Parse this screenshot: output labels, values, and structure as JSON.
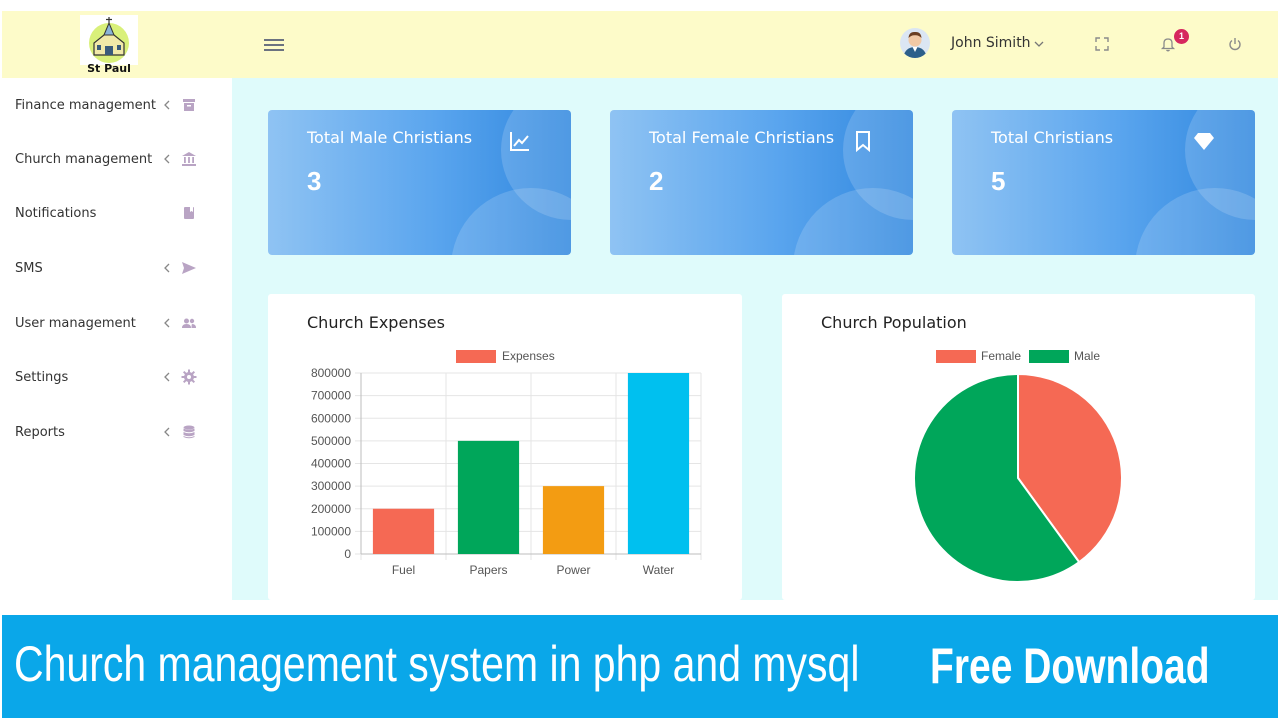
{
  "header": {
    "logo_text": "St Paul",
    "user_name": "John Simith",
    "notification_count": "1",
    "icons": [
      "menu-icon",
      "fullscreen-icon",
      "bell-icon",
      "power-icon"
    ]
  },
  "sidebar": {
    "items": [
      {
        "label": "Finance management",
        "icon": "archive-icon",
        "has_caret": true
      },
      {
        "label": "Church management",
        "icon": "bank-icon",
        "has_caret": true
      },
      {
        "label": "Notifications",
        "icon": "bookmark-icon",
        "has_caret": false
      },
      {
        "label": "SMS",
        "icon": "send-icon",
        "has_caret": true
      },
      {
        "label": "User management",
        "icon": "users-icon",
        "has_caret": true
      },
      {
        "label": "Settings",
        "icon": "gear-icon",
        "has_caret": true
      },
      {
        "label": "Reports",
        "icon": "database-icon",
        "has_caret": true
      }
    ]
  },
  "stats": [
    {
      "title": "Total Male Christians",
      "value": "3",
      "icon": "chart-line-icon"
    },
    {
      "title": "Total Female Christians",
      "value": "2",
      "icon": "bookmark-icon"
    },
    {
      "title": "Total Christians",
      "value": "5",
      "icon": "diamond-icon"
    }
  ],
  "colors": {
    "header_bg": "#fdfbc9",
    "content_bg": "#dffbfb",
    "banner_bg": "#0aa7e9",
    "fuel": "#f56954",
    "papers": "#00a65a",
    "power": "#f39c12",
    "water": "#00c0ef"
  },
  "expenses_card": {
    "title": "Church Expenses"
  },
  "population_card": {
    "title": "Church Population"
  },
  "chart_data": [
    {
      "type": "bar",
      "title": "Church Expenses",
      "categories": [
        "Fuel",
        "Papers",
        "Power",
        "Water"
      ],
      "series": [
        {
          "name": "Expenses",
          "values": [
            200000,
            500000,
            300000,
            800000
          ]
        }
      ],
      "bar_colors": [
        "#f56954",
        "#00a65a",
        "#f39c12",
        "#00c0ef"
      ],
      "legend_color": "#f56954",
      "ylim": [
        0,
        800000
      ],
      "yticks": [
        "0",
        "100000",
        "200000",
        "300000",
        "400000",
        "500000",
        "600000",
        "700000",
        "800000"
      ],
      "grid": true,
      "legend": "top"
    },
    {
      "type": "pie",
      "title": "Church Population",
      "labels": [
        "Female",
        "Male"
      ],
      "values": [
        2,
        3
      ],
      "colors": [
        "#f56954",
        "#00a65a"
      ],
      "legend": "top"
    }
  ],
  "banner": {
    "left_text": "Church management system in php and mysql",
    "right_text": "Free Download"
  }
}
